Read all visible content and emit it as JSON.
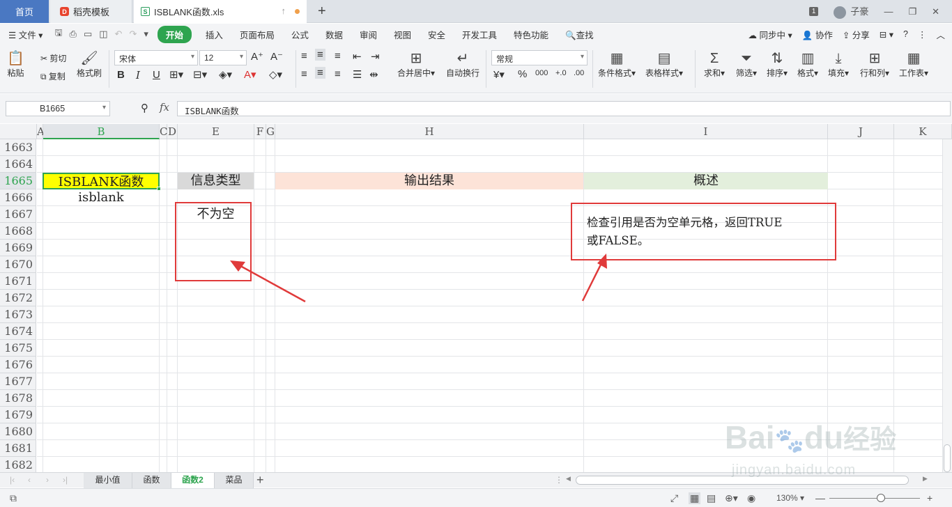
{
  "tabs": {
    "home": "首页",
    "template": "稻壳模板",
    "file": "ISBLANK函数.xls"
  },
  "window": {
    "badge": "1",
    "user": "子豪"
  },
  "menu": {
    "file": "文件",
    "items": [
      "开始",
      "插入",
      "页面布局",
      "公式",
      "数据",
      "审阅",
      "视图",
      "安全",
      "开发工具",
      "特色功能",
      "查找"
    ],
    "right": [
      "同步中",
      "协作",
      "分享"
    ]
  },
  "ribbon": {
    "paste": "粘贴",
    "cut": "剪切",
    "copy": "复制",
    "format_painter": "格式刷",
    "font_name": "宋体",
    "font_size": "12",
    "merge": "合并居中",
    "wrap": "自动换行",
    "number_format": "常规",
    "cond_format": "条件格式",
    "table_style": "表格样式",
    "sum": "求和",
    "filter": "筛选",
    "sort": "排序",
    "format": "格式",
    "fill": "填充",
    "row_col": "行和列",
    "worksheet": "工作表"
  },
  "formula": {
    "namebox": "B1665",
    "fx": "fx",
    "content": "ISBLANK函数"
  },
  "columns": [
    "A",
    "B",
    "C",
    "D",
    "E",
    "F",
    "G",
    "H",
    "I",
    "J",
    "K"
  ],
  "rows": [
    "1663",
    "1664",
    "1665",
    "1666",
    "1667",
    "1668",
    "1669",
    "1670",
    "1671",
    "1672",
    "1673",
    "1674",
    "1675",
    "1676",
    "1677",
    "1678",
    "1679",
    "1680",
    "1681",
    "1682"
  ],
  "cells": {
    "b1665": "ISBLANK函数",
    "b1666": "isblank",
    "e1665": "信息类型",
    "e1667": "不为空",
    "h1665": "输出结果",
    "i1665": "概述",
    "i1667_line1": "检查引用是否为空单元格，返回TRUE",
    "i1667_line2": "或FALSE。"
  },
  "colors": {
    "yellow": "#ffff00",
    "peach": "#fde3d8",
    "green_light": "#e3efdc",
    "gray": "#d9d9d9",
    "accent": "#2ea44f",
    "annotation": "#e03a3a"
  },
  "sheets": [
    "最小值",
    "函数",
    "函数2",
    "菜品"
  ],
  "active_sheet": "函数2",
  "status": {
    "zoom": "130%"
  },
  "watermark": {
    "brand": "Bai",
    "suffix": "du",
    "cn": "经验",
    "url": "jingyan.baidu.com"
  }
}
